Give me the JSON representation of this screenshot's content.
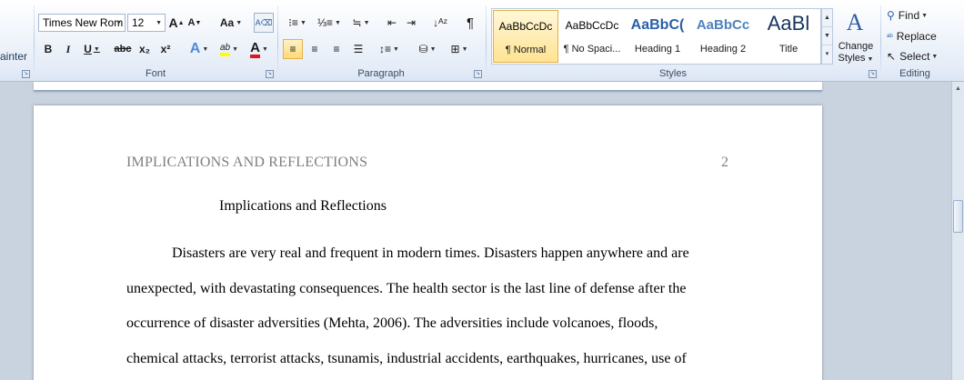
{
  "ribbon": {
    "clipboard": {
      "format_painter_partial": "ainter"
    },
    "font": {
      "label": "Font",
      "font_name": "Times New Rom",
      "font_size": "12",
      "grow_label": "A",
      "shrink_label": "A",
      "change_case_label": "Aa",
      "bold": "B",
      "italic": "I",
      "underline": "U",
      "strikethrough": "abc",
      "subscript": "x₂",
      "superscript": "x²",
      "text_effects": "A",
      "highlight": "ab",
      "font_color": "A"
    },
    "paragraph": {
      "label": "Paragraph",
      "pilcrow": "¶"
    },
    "styles": {
      "label": "Styles",
      "items": [
        {
          "preview": "AaBbCcDc",
          "name": "¶ Normal"
        },
        {
          "preview": "AaBbCcDc",
          "name": "¶ No Spaci..."
        },
        {
          "preview": "AaBbC(",
          "name": "Heading 1"
        },
        {
          "preview": "AaBbCc",
          "name": "Heading 2"
        },
        {
          "preview": "AaBl",
          "name": "Title"
        }
      ],
      "change_styles_line1": "Change",
      "change_styles_line2": "Styles"
    },
    "editing": {
      "label": "Editing",
      "find": "Find",
      "replace": "Replace",
      "select": "Select"
    }
  },
  "document": {
    "running_head": "IMPLICATIONS AND REFLECTIONS",
    "page_number": "2",
    "title": "Implications and Reflections",
    "lines": [
      "Disasters are very real and frequent in modern times. Disasters happen anywhere and are",
      "unexpected, with devastating consequences. The health sector is the last line of defense after the",
      "occurrence of disaster adversities (Mehta, 2006). The adversities include volcanoes, floods,",
      "chemical attacks, terrorist attacks, tsunamis, industrial accidents, earthquakes, hurricanes, use of"
    ]
  },
  "colors": {
    "ribbon_top": "#ffffff",
    "ribbon_bottom": "#dbe5f3",
    "workspace": "#c9d3df",
    "selected_style": "#ffe393",
    "heading_blue": "#2a5ea8",
    "header_gray": "#7f7f7f"
  }
}
